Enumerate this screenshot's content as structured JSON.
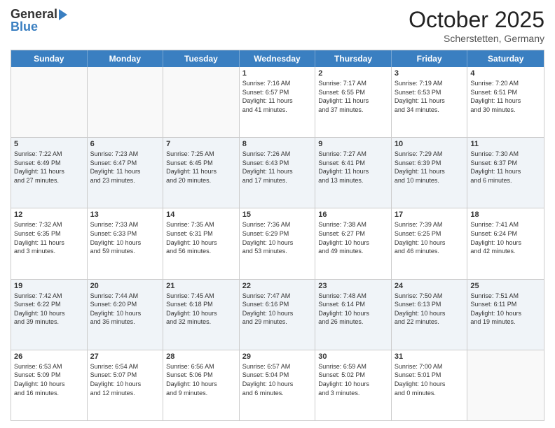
{
  "header": {
    "logo_general": "General",
    "logo_blue": "Blue",
    "month": "October 2025",
    "location": "Scherstetten, Germany"
  },
  "days_of_week": [
    "Sunday",
    "Monday",
    "Tuesday",
    "Wednesday",
    "Thursday",
    "Friday",
    "Saturday"
  ],
  "rows": [
    [
      {
        "date": "",
        "info": ""
      },
      {
        "date": "",
        "info": ""
      },
      {
        "date": "",
        "info": ""
      },
      {
        "date": "1",
        "info": "Sunrise: 7:16 AM\nSunset: 6:57 PM\nDaylight: 11 hours\nand 41 minutes."
      },
      {
        "date": "2",
        "info": "Sunrise: 7:17 AM\nSunset: 6:55 PM\nDaylight: 11 hours\nand 37 minutes."
      },
      {
        "date": "3",
        "info": "Sunrise: 7:19 AM\nSunset: 6:53 PM\nDaylight: 11 hours\nand 34 minutes."
      },
      {
        "date": "4",
        "info": "Sunrise: 7:20 AM\nSunset: 6:51 PM\nDaylight: 11 hours\nand 30 minutes."
      }
    ],
    [
      {
        "date": "5",
        "info": "Sunrise: 7:22 AM\nSunset: 6:49 PM\nDaylight: 11 hours\nand 27 minutes."
      },
      {
        "date": "6",
        "info": "Sunrise: 7:23 AM\nSunset: 6:47 PM\nDaylight: 11 hours\nand 23 minutes."
      },
      {
        "date": "7",
        "info": "Sunrise: 7:25 AM\nSunset: 6:45 PM\nDaylight: 11 hours\nand 20 minutes."
      },
      {
        "date": "8",
        "info": "Sunrise: 7:26 AM\nSunset: 6:43 PM\nDaylight: 11 hours\nand 17 minutes."
      },
      {
        "date": "9",
        "info": "Sunrise: 7:27 AM\nSunset: 6:41 PM\nDaylight: 11 hours\nand 13 minutes."
      },
      {
        "date": "10",
        "info": "Sunrise: 7:29 AM\nSunset: 6:39 PM\nDaylight: 11 hours\nand 10 minutes."
      },
      {
        "date": "11",
        "info": "Sunrise: 7:30 AM\nSunset: 6:37 PM\nDaylight: 11 hours\nand 6 minutes."
      }
    ],
    [
      {
        "date": "12",
        "info": "Sunrise: 7:32 AM\nSunset: 6:35 PM\nDaylight: 11 hours\nand 3 minutes."
      },
      {
        "date": "13",
        "info": "Sunrise: 7:33 AM\nSunset: 6:33 PM\nDaylight: 10 hours\nand 59 minutes."
      },
      {
        "date": "14",
        "info": "Sunrise: 7:35 AM\nSunset: 6:31 PM\nDaylight: 10 hours\nand 56 minutes."
      },
      {
        "date": "15",
        "info": "Sunrise: 7:36 AM\nSunset: 6:29 PM\nDaylight: 10 hours\nand 53 minutes."
      },
      {
        "date": "16",
        "info": "Sunrise: 7:38 AM\nSunset: 6:27 PM\nDaylight: 10 hours\nand 49 minutes."
      },
      {
        "date": "17",
        "info": "Sunrise: 7:39 AM\nSunset: 6:25 PM\nDaylight: 10 hours\nand 46 minutes."
      },
      {
        "date": "18",
        "info": "Sunrise: 7:41 AM\nSunset: 6:24 PM\nDaylight: 10 hours\nand 42 minutes."
      }
    ],
    [
      {
        "date": "19",
        "info": "Sunrise: 7:42 AM\nSunset: 6:22 PM\nDaylight: 10 hours\nand 39 minutes."
      },
      {
        "date": "20",
        "info": "Sunrise: 7:44 AM\nSunset: 6:20 PM\nDaylight: 10 hours\nand 36 minutes."
      },
      {
        "date": "21",
        "info": "Sunrise: 7:45 AM\nSunset: 6:18 PM\nDaylight: 10 hours\nand 32 minutes."
      },
      {
        "date": "22",
        "info": "Sunrise: 7:47 AM\nSunset: 6:16 PM\nDaylight: 10 hours\nand 29 minutes."
      },
      {
        "date": "23",
        "info": "Sunrise: 7:48 AM\nSunset: 6:14 PM\nDaylight: 10 hours\nand 26 minutes."
      },
      {
        "date": "24",
        "info": "Sunrise: 7:50 AM\nSunset: 6:13 PM\nDaylight: 10 hours\nand 22 minutes."
      },
      {
        "date": "25",
        "info": "Sunrise: 7:51 AM\nSunset: 6:11 PM\nDaylight: 10 hours\nand 19 minutes."
      }
    ],
    [
      {
        "date": "26",
        "info": "Sunrise: 6:53 AM\nSunset: 5:09 PM\nDaylight: 10 hours\nand 16 minutes."
      },
      {
        "date": "27",
        "info": "Sunrise: 6:54 AM\nSunset: 5:07 PM\nDaylight: 10 hours\nand 12 minutes."
      },
      {
        "date": "28",
        "info": "Sunrise: 6:56 AM\nSunset: 5:06 PM\nDaylight: 10 hours\nand 9 minutes."
      },
      {
        "date": "29",
        "info": "Sunrise: 6:57 AM\nSunset: 5:04 PM\nDaylight: 10 hours\nand 6 minutes."
      },
      {
        "date": "30",
        "info": "Sunrise: 6:59 AM\nSunset: 5:02 PM\nDaylight: 10 hours\nand 3 minutes."
      },
      {
        "date": "31",
        "info": "Sunrise: 7:00 AM\nSunset: 5:01 PM\nDaylight: 10 hours\nand 0 minutes."
      },
      {
        "date": "",
        "info": ""
      }
    ]
  ]
}
